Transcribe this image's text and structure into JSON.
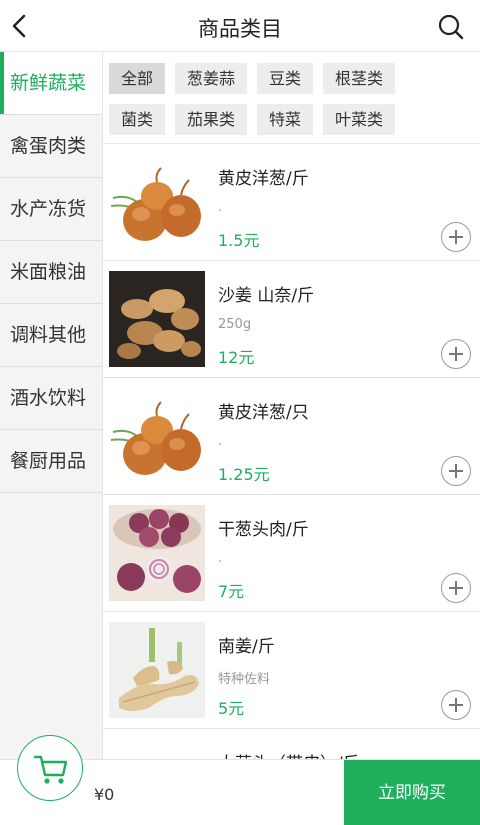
{
  "header": {
    "title": "商品类目",
    "back_icon": "chevron-left-icon",
    "search_icon": "search-icon"
  },
  "sidebar": {
    "items": [
      {
        "label": "新鲜蔬菜",
        "active": true
      },
      {
        "label": "禽蛋肉类",
        "active": false
      },
      {
        "label": "水产冻货",
        "active": false
      },
      {
        "label": "米面粮油",
        "active": false
      },
      {
        "label": "调料其他",
        "active": false
      },
      {
        "label": "酒水饮料",
        "active": false
      },
      {
        "label": "餐厨用品",
        "active": false
      }
    ]
  },
  "filters": {
    "selected": "全部",
    "rows": [
      [
        "全部",
        "葱姜蒜",
        "豆类",
        "根茎类"
      ],
      [
        "菌类",
        "茄果类",
        "特菜",
        "叶菜类"
      ]
    ]
  },
  "products": [
    {
      "name": "黄皮洋葱/斤",
      "desc": ".",
      "price": "1.5元",
      "image": "onion"
    },
    {
      "name": "沙姜 山奈/斤",
      "desc": "250g",
      "price": "12元",
      "image": "sand-ginger"
    },
    {
      "name": "黄皮洋葱/只",
      "desc": ".",
      "price": "1.25元",
      "image": "onion"
    },
    {
      "name": "干葱头肉/斤",
      "desc": ".",
      "price": "7元",
      "image": "shallot"
    },
    {
      "name": "南姜/斤",
      "desc": "特种佐料",
      "price": "5元",
      "image": "galangal"
    },
    {
      "name": "大蒜头（带皮）/斤",
      "desc": "",
      "price": "",
      "image": ""
    }
  ],
  "bottom_bar": {
    "cart_icon": "cart-icon",
    "total": "¥0",
    "buy_label": "立即购买"
  },
  "colors": {
    "accent": "#1fae5c",
    "sidebar_bg": "#f4f4f4",
    "chip_bg": "#ededed"
  }
}
